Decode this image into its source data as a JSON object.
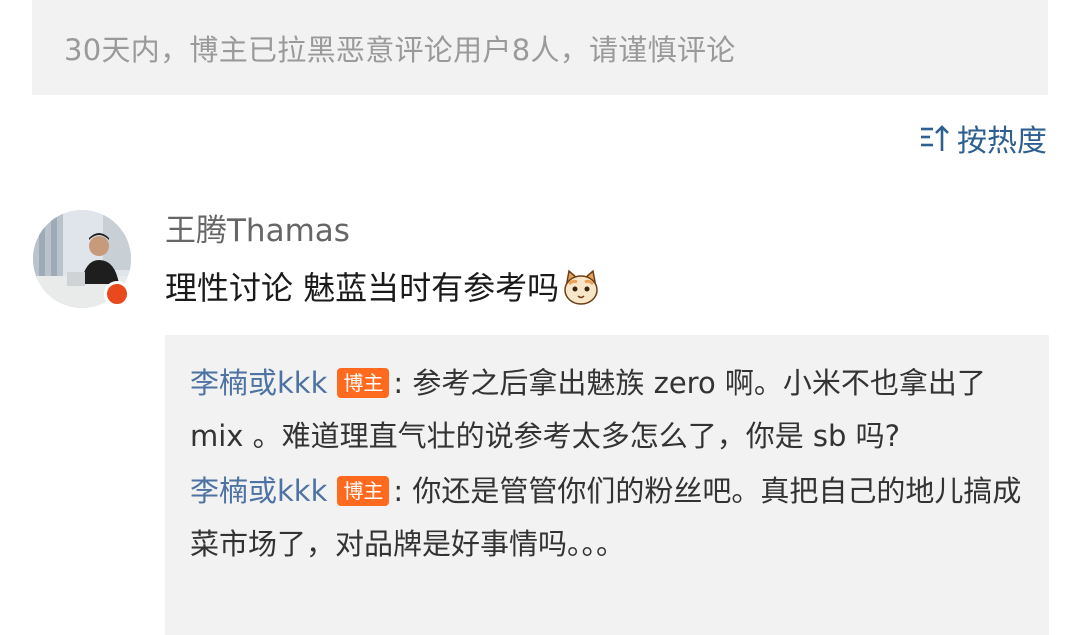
{
  "notice": {
    "text": "30天内，博主已拉黑恶意评论用户8人，请谨慎评论"
  },
  "sort": {
    "label": "按热度",
    "icon": "sort-icon"
  },
  "comment": {
    "username": "王腾Thamas",
    "text": "理性讨论 魅蓝当时有参考吗",
    "emoji": "cat-emoji-icon"
  },
  "replies": [
    {
      "user": "李楠或kkk",
      "tag": "博主",
      "text": ": 参考之后拿出魅族 zero 啊。小米不也拿出了 mix 。难道理直气壮的说参考太多怎么了，你是 sb 吗?"
    },
    {
      "user": "李楠或kkk",
      "tag": "博主",
      "text": ": 你还是管管你们的粉丝吧。真把自己的地儿搞成菜市场了，对品牌是好事情吗。。。"
    }
  ]
}
